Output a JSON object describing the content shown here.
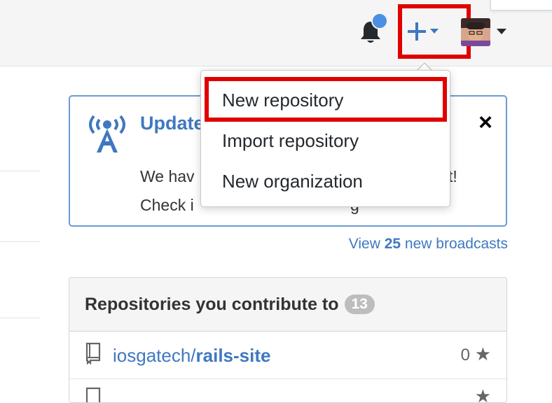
{
  "header": {
    "notification_icon": "bell-icon",
    "notification_dot_color": "#4a90e2",
    "create_icon": "plus-icon",
    "avatar_icon": "user-avatar"
  },
  "create_menu": {
    "items": [
      {
        "label": "New repository"
      },
      {
        "label": "Import repository"
      },
      {
        "label": "New organization"
      }
    ]
  },
  "broadcast": {
    "icon": "broadcast-icon",
    "title": "Update Statem",
    "body_line1": "We hav",
    "body_line1_end": "t!",
    "body_line2": "Check i",
    "body_line2_end": "g",
    "close": "×",
    "view_prefix": "View ",
    "view_count": "25",
    "view_suffix": " new broadcasts"
  },
  "repositories": {
    "title": "Repositories you contribute to",
    "count": "13",
    "items": [
      {
        "owner": "iosgatech/",
        "name": "rails-site",
        "stars": "0"
      }
    ]
  },
  "colors": {
    "accent": "#4078c0",
    "highlight_red": "#e00000"
  }
}
